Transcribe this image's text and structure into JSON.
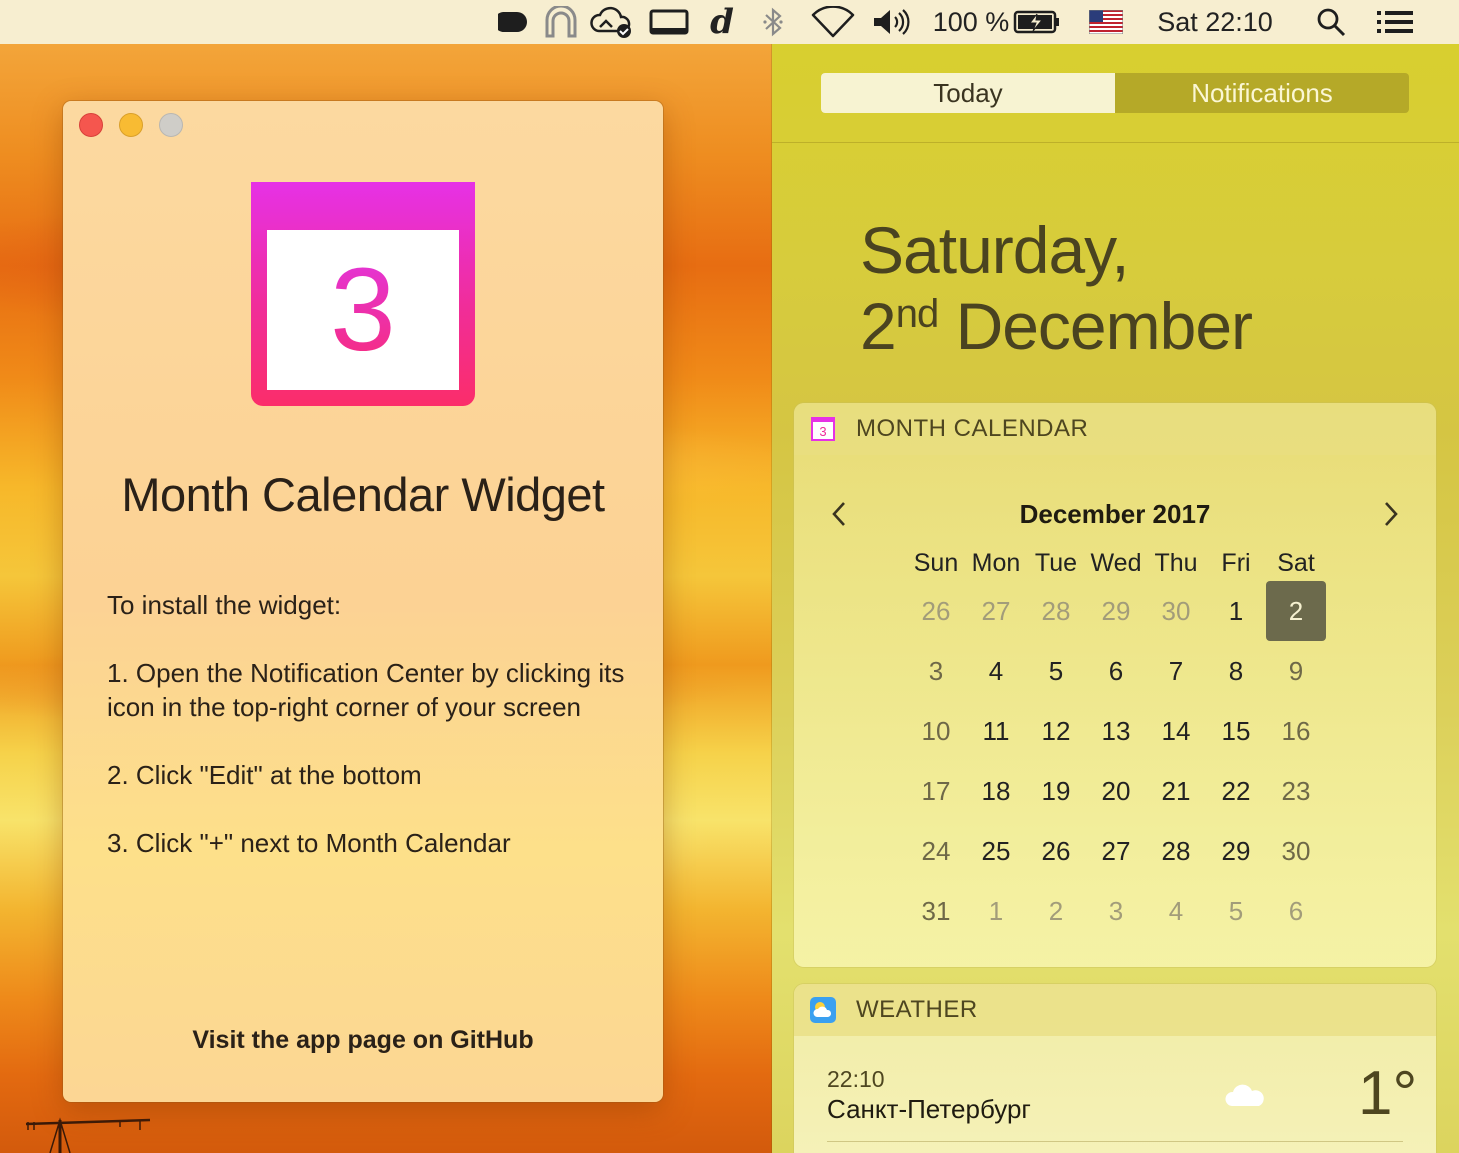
{
  "menubar": {
    "icons": [
      "adobe-cc-icon",
      "arch-icon",
      "cloud-sync-icon",
      "display-icon",
      "dictionary-icon",
      "bluetooth-icon",
      "wifi-icon",
      "volume-icon",
      "battery-icon",
      "us-flag-icon",
      "spotlight-search-icon",
      "notification-center-icon"
    ],
    "battery_percent": "100 %",
    "clock": "Sat 22:10",
    "dictionary_glyph": "d"
  },
  "window": {
    "icon_number": "3",
    "title": "Month Calendar Widget",
    "instructions": [
      "To install the widget:",
      "1. Open the Notification Center by clicking its icon in the top-right corner of your screen",
      "2. Click \"Edit\" at the bottom",
      "3. Click \"+\" next to Month Calendar"
    ],
    "github_link": "Visit the app page on GitHub"
  },
  "notification_center": {
    "tabs": {
      "today": "Today",
      "notifications": "Notifications"
    },
    "date_line1": "Saturday,",
    "date_day": "2",
    "date_suffix": "nd",
    "date_month": "December",
    "month_calendar": {
      "header": "MONTH CALENDAR",
      "icon_number": "3",
      "month_label": "December 2017",
      "weekdays": [
        "Sun",
        "Mon",
        "Tue",
        "Wed",
        "Thu",
        "Fri",
        "Sat"
      ],
      "weeks": [
        [
          "26",
          "27",
          "28",
          "29",
          "30",
          "1",
          "2"
        ],
        [
          "3",
          "4",
          "5",
          "6",
          "7",
          "8",
          "9"
        ],
        [
          "10",
          "11",
          "12",
          "13",
          "14",
          "15",
          "16"
        ],
        [
          "17",
          "18",
          "19",
          "20",
          "21",
          "22",
          "23"
        ],
        [
          "24",
          "25",
          "26",
          "27",
          "28",
          "29",
          "30"
        ],
        [
          "31",
          "1",
          "2",
          "3",
          "4",
          "5",
          "6"
        ]
      ],
      "today": "2"
    },
    "weather": {
      "header": "WEATHER",
      "time": "22:10",
      "city": "Санкт-Петербург",
      "temperature": "1°"
    }
  },
  "colors": {
    "accent_magenta": "#e631e6",
    "accent_pink": "#fb2d6a",
    "today_highlight": "#6c6a4c",
    "nc_background": "#d8cf2f"
  }
}
